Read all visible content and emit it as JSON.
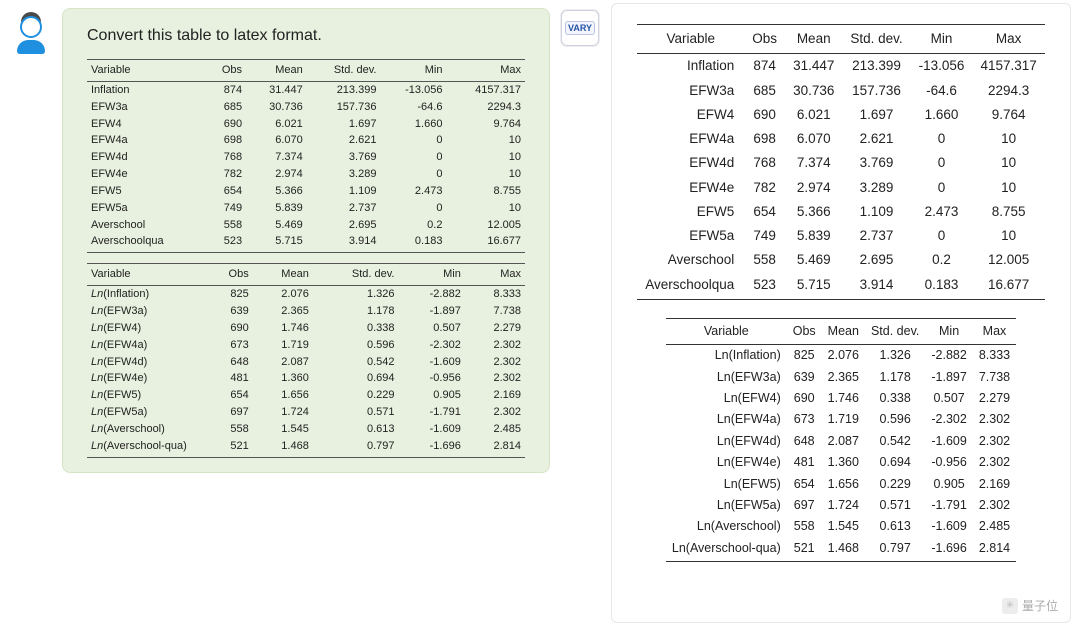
{
  "prompt": "Convert this table to latex format.",
  "bot_badge": "VARY",
  "watermark_text": "量子位",
  "watermark_glyph": "✳",
  "columns": [
    "Variable",
    "Obs",
    "Mean",
    "Std. dev.",
    "Min",
    "Max"
  ],
  "table_a": [
    {
      "v": "Inflation",
      "obs": "874",
      "mean": "31.447",
      "sd": "213.399",
      "min": "-13.056",
      "max": "4157.317"
    },
    {
      "v": "EFW3a",
      "obs": "685",
      "mean": "30.736",
      "sd": "157.736",
      "min": "-64.6",
      "max": "2294.3"
    },
    {
      "v": "EFW4",
      "obs": "690",
      "mean": "6.021",
      "sd": "1.697",
      "min": "1.660",
      "max": "9.764"
    },
    {
      "v": "EFW4a",
      "obs": "698",
      "mean": "6.070",
      "sd": "2.621",
      "min": "0",
      "max": "10"
    },
    {
      "v": "EFW4d",
      "obs": "768",
      "mean": "7.374",
      "sd": "3.769",
      "min": "0",
      "max": "10"
    },
    {
      "v": "EFW4e",
      "obs": "782",
      "mean": "2.974",
      "sd": "3.289",
      "min": "0",
      "max": "10"
    },
    {
      "v": "EFW5",
      "obs": "654",
      "mean": "5.366",
      "sd": "1.109",
      "min": "2.473",
      "max": "8.755"
    },
    {
      "v": "EFW5a",
      "obs": "749",
      "mean": "5.839",
      "sd": "2.737",
      "min": "0",
      "max": "10"
    },
    {
      "v": "Averschool",
      "obs": "558",
      "mean": "5.469",
      "sd": "2.695",
      "min": "0.2",
      "max": "12.005"
    },
    {
      "v": "Averschoolqua",
      "obs": "523",
      "mean": "5.715",
      "sd": "3.914",
      "min": "0.183",
      "max": "16.677"
    }
  ],
  "table_b": [
    {
      "v": "Ln(Inflation)",
      "obs": "825",
      "mean": "2.076",
      "sd": "1.326",
      "min": "-2.882",
      "max": "8.333"
    },
    {
      "v": "Ln(EFW3a)",
      "obs": "639",
      "mean": "2.365",
      "sd": "1.178",
      "min": "-1.897",
      "max": "7.738"
    },
    {
      "v": "Ln(EFW4)",
      "obs": "690",
      "mean": "1.746",
      "sd": "0.338",
      "min": "0.507",
      "max": "2.279"
    },
    {
      "v": "Ln(EFW4a)",
      "obs": "673",
      "mean": "1.719",
      "sd": "0.596",
      "min": "-2.302",
      "max": "2.302"
    },
    {
      "v": "Ln(EFW4d)",
      "obs": "648",
      "mean": "2.087",
      "sd": "0.542",
      "min": "-1.609",
      "max": "2.302"
    },
    {
      "v": "Ln(EFW4e)",
      "obs": "481",
      "mean": "1.360",
      "sd": "0.694",
      "min": "-0.956",
      "max": "2.302"
    },
    {
      "v": "Ln(EFW5)",
      "obs": "654",
      "mean": "1.656",
      "sd": "0.229",
      "min": "0.905",
      "max": "2.169"
    },
    {
      "v": "Ln(EFW5a)",
      "obs": "697",
      "mean": "1.724",
      "sd": "0.571",
      "min": "-1.791",
      "max": "2.302"
    },
    {
      "v": "Ln(Averschool)",
      "obs": "558",
      "mean": "1.545",
      "sd": "0.613",
      "min": "-1.609",
      "max": "2.485"
    },
    {
      "v": "Ln(Averschool-qua)",
      "obs": "521",
      "mean": "1.468",
      "sd": "0.797",
      "min": "-1.696",
      "max": "2.814"
    }
  ]
}
